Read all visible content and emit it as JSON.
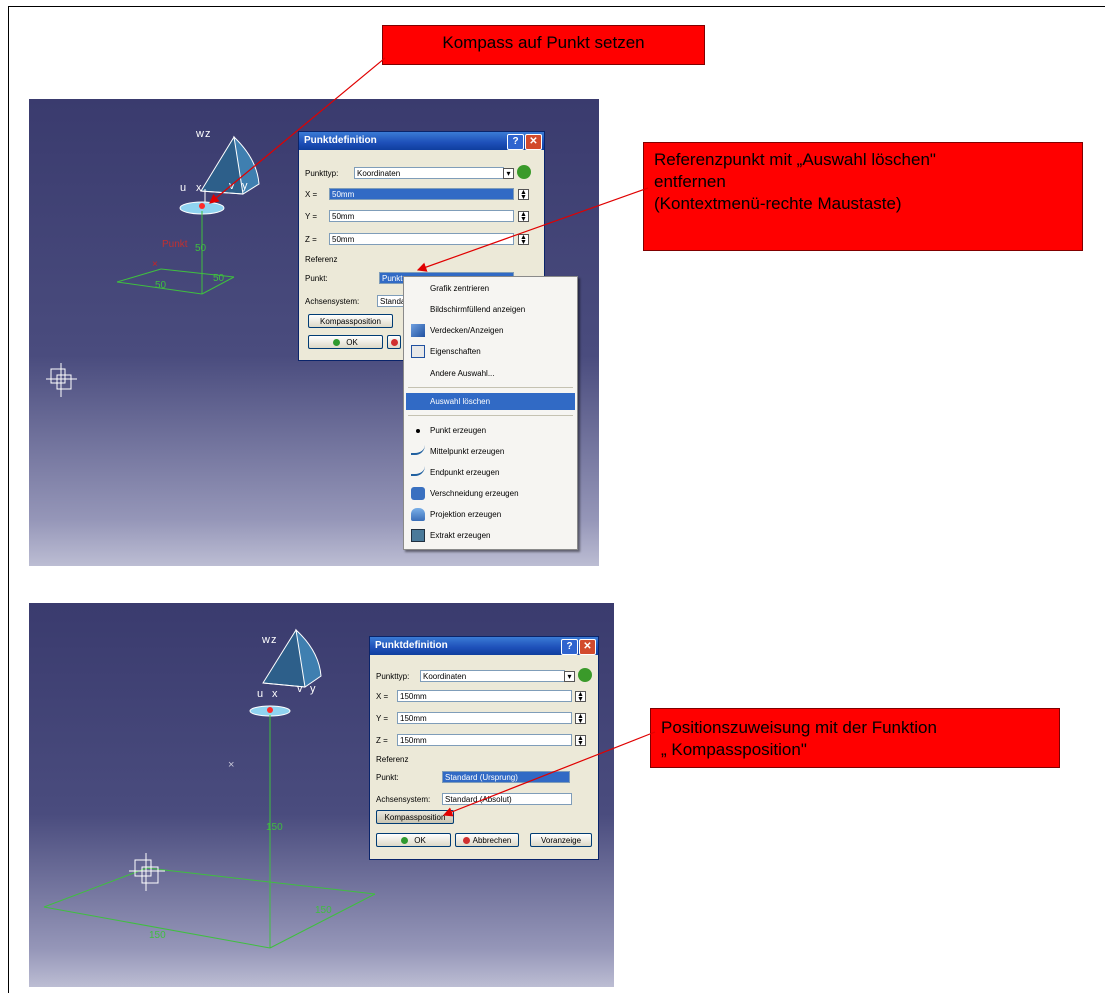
{
  "callouts": {
    "c1": "Kompass auf Punkt setzen",
    "c2_line1": "Referenzpunkt mit „Auswahl löschen\"",
    "c2_line2": "entfernen",
    "c2_line3": "(Kontextmenü-rechte Maustaste)",
    "c3_line1": "Positionszuweisung mit der Funktion",
    "c3_line2": "„ Kompassposition\""
  },
  "compass": {
    "w": "w",
    "z": "z",
    "u": "u",
    "x": "x",
    "v": "v",
    "y": "y"
  },
  "scene1": {
    "point_label": "Punkt",
    "dim_z": "50",
    "dim_x": "50",
    "dim_y": "50"
  },
  "scene2": {
    "dim_z": "150",
    "dim_x": "150",
    "dim_y": "150"
  },
  "dialog1": {
    "title": "Punktdefinition",
    "help_glyph": "?",
    "close_glyph": "✕",
    "punkttyp_label": "Punkttyp:",
    "punkttyp_value": "Koordinaten",
    "x_label": "X =",
    "x_value": "50mm",
    "y_label": "Y =",
    "y_value": "50mm",
    "z_label": "Z =",
    "z_value": "50mm",
    "referenz_label": "Referenz",
    "punkt_label": "Punkt:",
    "punkt_value": "Punkt",
    "achsensystem_label": "Achsensystem:",
    "achsensystem_value": "Standa",
    "kompass_button": "Kompassposition",
    "ok_button": "OK"
  },
  "context_menu": {
    "items": [
      "Grafik zentrieren",
      "Bildschirmfüllend anzeigen",
      "Verdecken/Anzeigen",
      "Eigenschaften",
      "Andere Auswahl...",
      "Auswahl löschen",
      "Punkt erzeugen",
      "Mittelpunkt erzeugen",
      "Endpunkt erzeugen",
      "Verschneidung erzeugen",
      "Projektion erzeugen",
      "Extrakt erzeugen"
    ]
  },
  "dialog2": {
    "title": "Punktdefinition",
    "help_glyph": "?",
    "close_glyph": "✕",
    "punkttyp_label": "Punkttyp:",
    "punkttyp_value": "Koordinaten",
    "x_label": "X =",
    "x_value": "150mm",
    "y_label": "Y =",
    "y_value": "150mm",
    "z_label": "Z =",
    "z_value": "150mm",
    "referenz_label": "Referenz",
    "punkt_label": "Punkt:",
    "punkt_value": "Standard (Ursprung)",
    "achsensystem_label": "Achsensystem:",
    "achsensystem_value": "Standard (Absolut)",
    "kompass_button": "Kompassposition",
    "ok_button": "OK",
    "abbrechen_button": "Abbrechen",
    "voranzeige_button": "Voranzeige"
  },
  "colors": {
    "callout_red": "#ff0000",
    "geometry_green": "#3fbf3f",
    "selection_blue": "#316ac5",
    "viewport_top": "#3a3b6e",
    "viewport_bottom": "#bcbdd3"
  }
}
